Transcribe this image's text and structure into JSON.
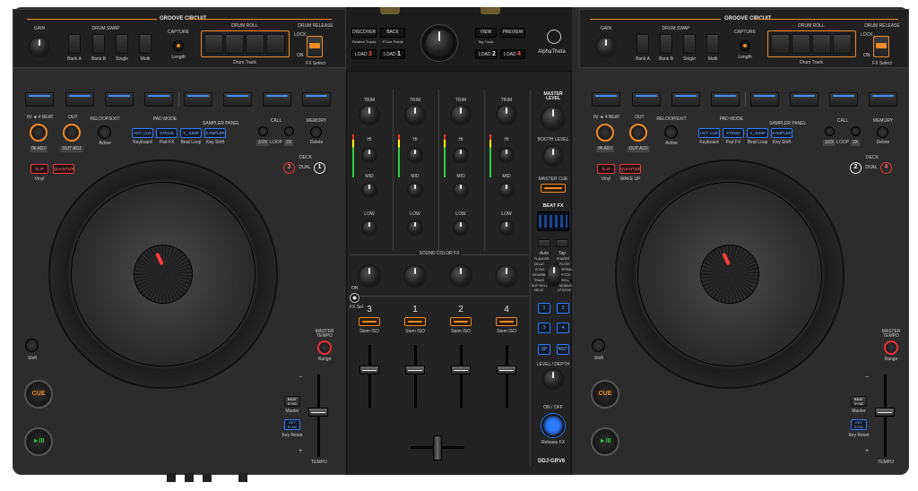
{
  "left_top": {
    "gain": "GAIN",
    "groove_circuit": "GROOVE CIRCUIT",
    "drum_swap": "DRUM SWAP",
    "bank_a": "Bank A",
    "bank_b": "Bank B",
    "single": "Single",
    "multi": "Multi",
    "capture": "CAPTURE",
    "length": "Length",
    "drum_roll": "DRUM ROLL",
    "drum_track": "Drum Track",
    "drum_release": "DRUM RELEASE",
    "lock": "LOCK",
    "on": "ON",
    "fx_select": "FX Select"
  },
  "right_top": {
    "gain": "GAIN",
    "groove_circuit": "GROOVE CIRCUIT",
    "drum_swap": "DRUM SWAP",
    "bank_a": "Bank A",
    "bank_b": "Bank B",
    "single": "Single",
    "multi": "Multi",
    "capture": "CAPTURE",
    "length": "Length",
    "drum_roll": "DRUM ROLL",
    "drum_track": "Drum Track",
    "drum_release": "DRUM RELEASE",
    "lock": "LOCK",
    "on": "ON",
    "fx_select": "FX Select"
  },
  "browser": {
    "discover": "DISCOVER",
    "back": "BACK",
    "related_tracks": "Related Tracks",
    "cue_points": "P.Cue Points",
    "view": "VIEW",
    "preview": "PREVIEW",
    "tag_track": "Tag Track",
    "load": "LOAD",
    "load_nums": [
      "3",
      "1",
      "2",
      "4"
    ],
    "brand": "AlphaTheta"
  },
  "deck_left": {
    "in_beat": "IN ◄ 4 BEAT",
    "in": "IN",
    "out": "OUT",
    "reloop": "RELOOP/EXIT",
    "active": "Active",
    "in_adj": "IN ADJ",
    "out_adj": "OUT ADJ",
    "pad_mode": "PAD MODE",
    "sampler_panel": "SAMPLER PANEL",
    "hot_cue": "HOT CUE",
    "stems": "STEMS",
    "x_jump": "X_JUMP",
    "sampler": "SAMPLER",
    "keyboard": "Keyboard",
    "pad_fx": "Pad FX",
    "beat_loop": "Beat Loop",
    "key_shift": "Key Shift",
    "call": "CALL",
    "memory": "MEMORY",
    "loop": "LOOP",
    "half": "1/2X",
    "double": "2X",
    "delete": "Delete",
    "slip": "SLIP",
    "quantize": "QUANTIZE",
    "vinyl": "Vinyl",
    "deck": "DECK",
    "dual": "DUAL",
    "deck_a": "3",
    "deck_b": "1",
    "shift": "Shift",
    "master_tempo": "MASTER TEMPO",
    "range": "Range",
    "cue": "CUE",
    "play": "►/II",
    "beat_sync": "BEAT SYNC",
    "master": "Master",
    "key_sync": "KEY SYNC",
    "key_reset": "Key Reset",
    "tempo": "TEMPO",
    "plus": "+",
    "minus": "−"
  },
  "deck_right": {
    "in_beat": "IN ◄ 4 BEAT",
    "in": "IN",
    "out": "OUT",
    "reloop": "RELOOP/EXIT",
    "active": "Active",
    "in_adj": "IN ADJ",
    "out_adj": "OUT ADJ",
    "pad_mode": "PAD MODE",
    "sampler_panel": "SAMPLER PANEL",
    "hot_cue": "HOT CUE",
    "stems": "STEMS",
    "x_jump": "X_JUMP",
    "sampler": "SAMPLER",
    "keyboard": "Keyboard",
    "pad_fx": "Pad FX",
    "beat_loop": "Beat Loop",
    "key_shift": "Key Shift",
    "call": "CALL",
    "memory": "MEMORY",
    "loop": "LOOP",
    "half": "1/2X",
    "double": "2X",
    "delete": "Delete",
    "slip": "SLIP",
    "quantize": "QUANTIZE",
    "vinyl": "Vinyl",
    "wake_up": "WAKE UP",
    "deck": "DECK",
    "dual": "DUAL",
    "deck_a": "2",
    "deck_b": "4",
    "shift": "Shift",
    "master_tempo": "MASTER TEMPO",
    "range": "Range",
    "cue": "CUE",
    "play": "►/II",
    "beat_sync": "BEAT SYNC",
    "master": "Master",
    "key_sync": "KEY SYNC",
    "key_reset": "Key Reset",
    "tempo": "TEMPO",
    "plus": "+",
    "minus": "−"
  },
  "mixer": {
    "trim": "TRIM",
    "hi": "HI",
    "mid": "MID",
    "low": "LOW",
    "sound_color_fx": "SOUND COLOR FX",
    "on": "ON",
    "fx_sel": "FX Sel",
    "channels": [
      "3",
      "1",
      "2",
      "4"
    ],
    "stem_iso": "Stem ISO",
    "master_level": "MASTER LEVEL",
    "booth_level": "BOOTH LEVEL",
    "master_cue": "MASTER CUE",
    "beat_fx": "BEAT FX",
    "auto": "Auto",
    "tap": "Tap",
    "fx_names": [
      "FLANGER",
      "PHASER",
      "DELAY",
      "FILTER",
      "ECHO",
      "SPIRAL",
      "REVERB",
      "PITCH",
      "TRANS",
      "ROLL",
      "SLIP ROLL",
      "MOBIUS",
      "HELIX",
      "LP ECHO"
    ],
    "fx_ch": [
      "1",
      "2",
      "3",
      "4",
      "SP",
      "MST"
    ],
    "level_depth": "LEVEL / DEPTH",
    "on_off": "ON / OFF",
    "release_fx": "Release FX",
    "model": "DDJ-GRV6"
  }
}
